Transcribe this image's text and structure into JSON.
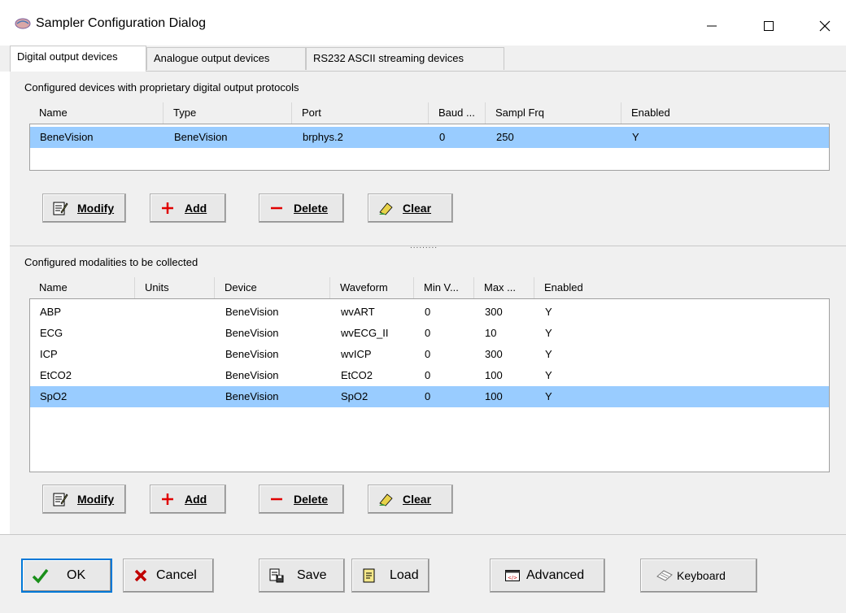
{
  "window": {
    "title": "Sampler Configuration Dialog",
    "controls": {
      "minimize": "—",
      "maximize": "☐",
      "close": "✕"
    }
  },
  "tabs": [
    {
      "label": "Digital output devices",
      "active": true
    },
    {
      "label": "Analogue output devices",
      "active": false
    },
    {
      "label": "RS232 ASCII streaming devices",
      "active": false
    }
  ],
  "devices": {
    "section_label": "Configured devices with proprietary digital output protocols",
    "columns": [
      "Name",
      "Type",
      "Port",
      "Baud ...",
      "Sampl Frq",
      "Enabled"
    ],
    "rows": [
      {
        "cells": [
          "BeneVision",
          "BeneVision",
          "brphys.2",
          "0",
          "250",
          "Y"
        ],
        "selected": true
      }
    ],
    "buttons": {
      "modify": "Modify",
      "add": "Add",
      "delete": "Delete",
      "clear": "Clear"
    }
  },
  "splitter": {
    "grip": "........."
  },
  "modalities": {
    "section_label": "Configured modalities to be collected",
    "columns": [
      "Name",
      "Units",
      "Device",
      "Waveform",
      "Min V...",
      "Max ...",
      "Enabled"
    ],
    "rows": [
      {
        "cells": [
          "ABP",
          "",
          "BeneVision",
          "wvART",
          "0",
          "300",
          "Y"
        ],
        "selected": false
      },
      {
        "cells": [
          "ECG",
          "",
          "BeneVision",
          "wvECG_II",
          "0",
          "10",
          "Y"
        ],
        "selected": false
      },
      {
        "cells": [
          "ICP",
          "",
          "BeneVision",
          "wvICP",
          "0",
          "300",
          "Y"
        ],
        "selected": false
      },
      {
        "cells": [
          "EtCO2",
          "",
          "BeneVision",
          "EtCO2",
          "0",
          "100",
          "Y"
        ],
        "selected": false
      },
      {
        "cells": [
          "SpO2",
          "",
          "BeneVision",
          "SpO2",
          "0",
          "100",
          "Y"
        ],
        "selected": true
      }
    ],
    "buttons": {
      "modify": "Modify",
      "add": "Add",
      "delete": "Delete",
      "clear": "Clear"
    }
  },
  "footer": {
    "ok": "OK",
    "cancel": "Cancel",
    "save": "Save",
    "load": "Load",
    "advanced": "Advanced",
    "keyboard": "Keyboard"
  },
  "colors": {
    "selection": "#99ccff",
    "panel": "#f0f0f0",
    "add_icon": "#e00000",
    "delete_icon": "#e00000",
    "ok_check": "#1a8f1a",
    "cancel_x": "#c00000",
    "focus_border": "#0078d7"
  }
}
